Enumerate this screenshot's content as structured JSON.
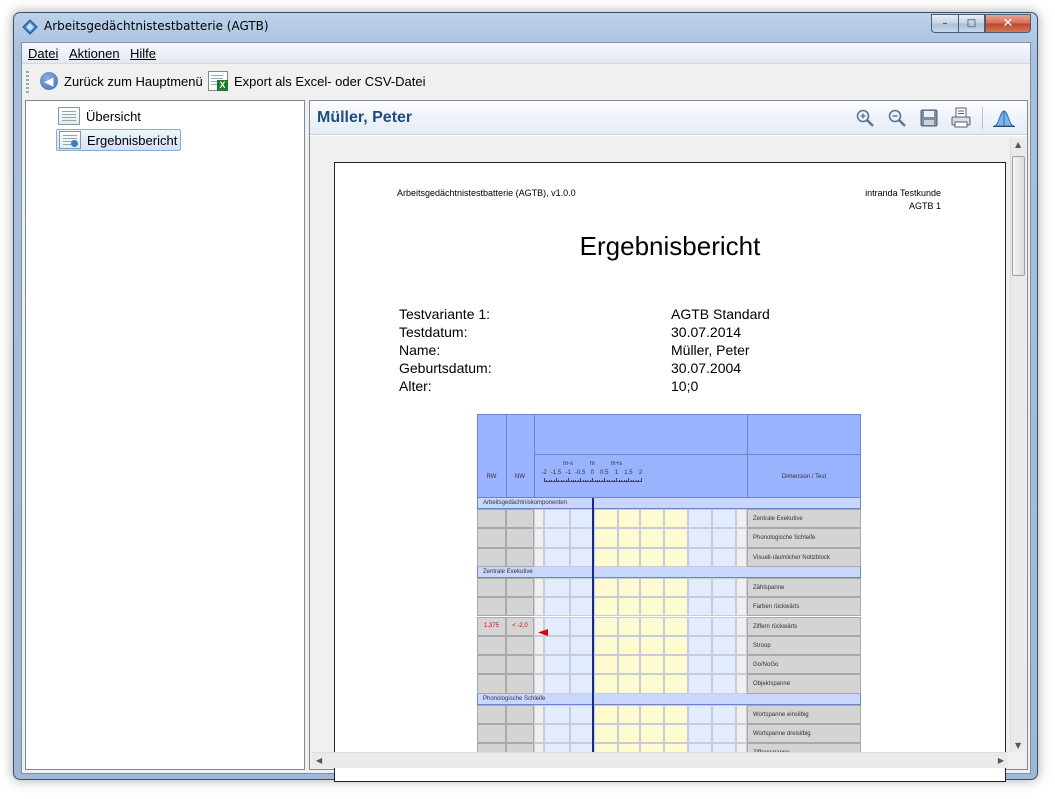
{
  "window": {
    "title": "Arbeitsgedächtnistestbatterie (AGTB)",
    "min": "–",
    "max": "□",
    "close": "✕"
  },
  "menu": [
    "Datei",
    "Aktionen",
    "Hilfe"
  ],
  "toolbar": {
    "back": "Zurück zum Hauptmenü",
    "export": "Export als Excel- oder CSV-Datei"
  },
  "tree": [
    "Übersicht",
    "Ergebnisbericht"
  ],
  "panel": {
    "patient_name": "Müller, Peter",
    "tools": [
      "zoom-in-icon",
      "zoom-out-icon",
      "save-icon",
      "print-icon",
      "distribution-icon"
    ]
  },
  "report": {
    "header_left": "Arbeitsgedächtnistestbatterie (AGTB), v1.0.0",
    "header_right_1": "intranda Testkunde",
    "header_right_2": "AGTB 1",
    "title": "Ergebnisbericht",
    "info": [
      {
        "label": "Testvariante 1:",
        "value": "AGTB Standard"
      },
      {
        "label": "Testdatum:",
        "value": "30.07.2014"
      },
      {
        "label": "Name:",
        "value": "Müller, Peter"
      },
      {
        "label": "Geburtsdatum:",
        "value": "30.07.2004"
      },
      {
        "label": "Alter:",
        "value": "10;0"
      }
    ],
    "table": {
      "col_rw": "RW",
      "col_nw": "NW",
      "col_dim": "Dimension / Test",
      "scale_top": [
        "m-s",
        "m",
        "m+s"
      ],
      "scale_ticks": [
        "-2",
        "-1.5",
        "-1",
        "-0.5",
        "0",
        "0.5",
        "1",
        "1.5",
        "2"
      ],
      "sections": [
        {
          "title": "Arbeitsgedächtniskomponenten",
          "rows": [
            {
              "name": "Zentrale Exekutive"
            },
            {
              "name": "Phonologische Schleife"
            },
            {
              "name": "Visuell-räumlicher Notizblock"
            }
          ]
        },
        {
          "title": "Zentrale Exekutive",
          "rows": [
            {
              "name": "Zählspanne"
            },
            {
              "name": "Farben rückwärts"
            },
            {
              "name": "Ziffern rückwärts",
              "rw": "1,375",
              "nw": "< -2,0",
              "marker": true
            },
            {
              "name": "Stroop"
            },
            {
              "name": "Go/NoGo"
            },
            {
              "name": "Objektspanne"
            }
          ]
        },
        {
          "title": "Phonologische Schleife",
          "rows": [
            {
              "name": "Wortspanne einsilbig"
            },
            {
              "name": "Wortspanne dreisilbig"
            },
            {
              "name": "Ziffernspanne"
            }
          ]
        }
      ],
      "colors": {
        "header": "#99b3ff",
        "section": "#c9d7ff",
        "grey": "#d4d4d4",
        "blue": "#e3ebff",
        "yellow": "#fffbd0",
        "marker": "#e00000"
      }
    }
  }
}
